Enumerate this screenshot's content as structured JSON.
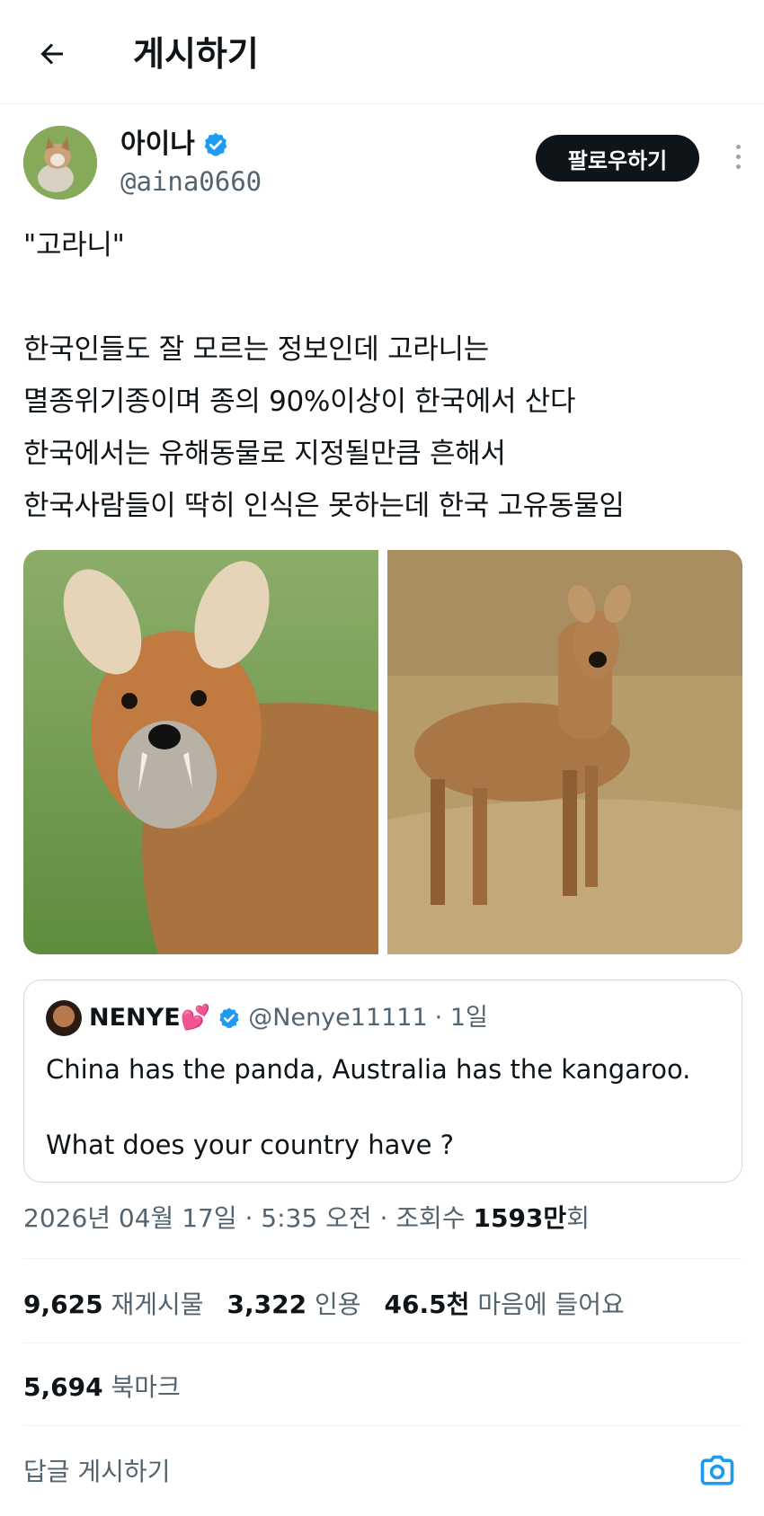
{
  "header": {
    "title": "게시하기",
    "back_icon": "arrow-left-icon"
  },
  "author": {
    "display_name": "아이나",
    "verified_icon": "verified-badge-icon",
    "handle": "@aina0660",
    "follow_label": "팔로우하기",
    "more_icon": "more-vertical-icon"
  },
  "post": {
    "text": "\"고라니\"\n\n한국인들도 잘 모르는 정보인데 고라니는\n멸종위기종이며 종의 90%이상이 한국에서 산다\n한국에서는 유해동물로 지정될만큼 흔해서\n한국사람들이 딱히 인식은 못하는데 한국 고유동물임"
  },
  "quote": {
    "name": "NENYE💕",
    "handle": "@Nenye11111",
    "time": "· 1일",
    "text": "China has the panda, Australia has the kangaroo.\n\nWhat does your country have ?"
  },
  "meta": {
    "timestamp": "2026년 04월 17일 · 5:35 오전 · 조회수 ",
    "views": "1593만",
    "views_suffix": "회"
  },
  "stats": {
    "reposts_count": "9,625",
    "reposts_label": "재게시물",
    "quotes_count": "3,322",
    "quotes_label": "인용",
    "likes_count": "46.5천",
    "likes_label": "마음에 들어요",
    "bookmarks_count": "5,694",
    "bookmarks_label": "북마크"
  },
  "reply": {
    "placeholder": "답글 게시하기",
    "camera_icon": "camera-icon"
  },
  "colors": {
    "primary_text": "#0f1419",
    "secondary_text": "#536471",
    "verified_blue": "#1d9bf0",
    "border": "#cfd9de"
  }
}
